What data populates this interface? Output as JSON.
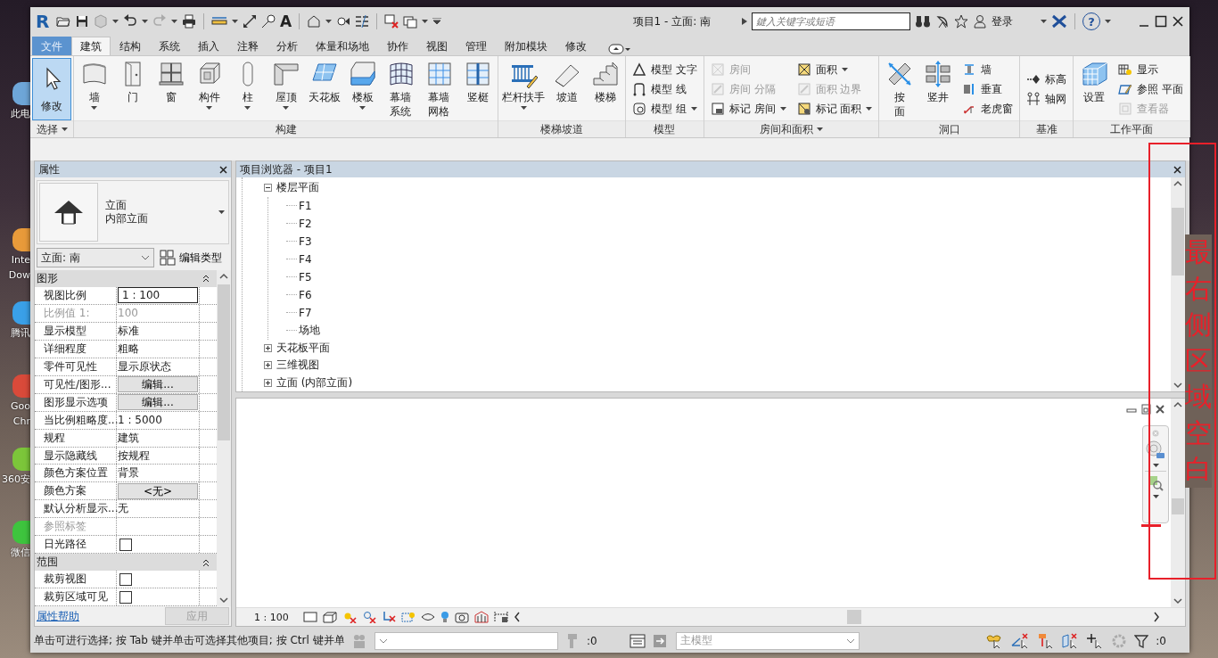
{
  "desktop_icons": [
    {
      "lines": [
        "此电"
      ]
    },
    {
      "lines": [
        "Inte",
        "Dow"
      ]
    },
    {
      "lines": [
        "腾讯"
      ]
    },
    {
      "lines": [
        "Goo",
        "Chr"
      ]
    },
    {
      "lines": [
        "360安"
      ]
    },
    {
      "lines": [
        "微信"
      ]
    }
  ],
  "window": {
    "logo": "R",
    "text_tool": "A",
    "title": "项目1 - 立面: 南",
    "search": {
      "placeholder": "鍵入关键字或短语"
    },
    "login": "登录",
    "help": "?"
  },
  "tabs": [
    {
      "label": "文件",
      "kind": "file",
      "selected": false
    },
    {
      "label": "建筑",
      "kind": "tab",
      "selected": true
    },
    {
      "label": "结构",
      "kind": "tab",
      "selected": false
    },
    {
      "label": "系统",
      "kind": "tab",
      "selected": false
    },
    {
      "label": "插入",
      "kind": "tab",
      "selected": false
    },
    {
      "label": "注释",
      "kind": "tab",
      "selected": false
    },
    {
      "label": "分析",
      "kind": "tab",
      "selected": false
    },
    {
      "label": "体量和场地",
      "kind": "tab",
      "selected": false
    },
    {
      "label": "协作",
      "kind": "tab",
      "selected": false
    },
    {
      "label": "视图",
      "kind": "tab",
      "selected": false
    },
    {
      "label": "管理",
      "kind": "tab",
      "selected": false
    },
    {
      "label": "附加模块",
      "kind": "tab",
      "selected": false
    },
    {
      "label": "修改",
      "kind": "tab",
      "selected": false
    }
  ],
  "ribbon": [
    {
      "title": "选择",
      "menu": true,
      "tools": [
        {
          "label": "修改",
          "kind": "large",
          "selected": true
        }
      ]
    },
    {
      "title": "构建",
      "tools": [
        {
          "label": "墙",
          "kind": "large",
          "dropdown": true
        },
        {
          "label": "门",
          "kind": "large"
        },
        {
          "label": "窗",
          "kind": "large"
        },
        {
          "label": "构件",
          "kind": "large",
          "dropdown": true
        },
        {
          "label": "柱",
          "kind": "large",
          "dropdown": true
        },
        {
          "label": "屋顶",
          "kind": "large",
          "dropdown": true
        },
        {
          "label": "天花板",
          "kind": "large"
        },
        {
          "label": "楼板",
          "kind": "large",
          "dropdown": true
        },
        {
          "label": "幕墙系统",
          "kind": "large",
          "wrap": true
        },
        {
          "label": "幕墙网格",
          "kind": "large",
          "wrap": true
        },
        {
          "label": "竖梃",
          "kind": "large"
        }
      ]
    },
    {
      "title": "楼梯坡道",
      "tools": [
        {
          "label": "栏杆扶手",
          "kind": "large",
          "dropdown": true
        },
        {
          "label": "坡道",
          "kind": "large"
        },
        {
          "label": "楼梯",
          "kind": "large"
        }
      ]
    },
    {
      "title": "模型",
      "tools": [
        {
          "label": "模型 文字",
          "kind": "small"
        },
        {
          "label": "模型 线",
          "kind": "small"
        },
        {
          "label": "模型 组",
          "kind": "small",
          "dropdown": true
        }
      ]
    },
    {
      "title": "房间和面积",
      "menu": true,
      "tools": [
        {
          "label": "房间",
          "kind": "small",
          "disabled": true
        },
        {
          "label": "房间 分隔",
          "kind": "small",
          "disabled": true
        },
        {
          "label": "标记 房间",
          "kind": "small",
          "dropdown": true
        },
        {
          "label": "面积",
          "kind": "small",
          "dropdown": true
        },
        {
          "label": "面积 边界",
          "kind": "small",
          "disabled": true
        },
        {
          "label": "标记 面积",
          "kind": "small",
          "dropdown": true
        }
      ]
    },
    {
      "title": "洞口",
      "tools": [
        {
          "label": "按面",
          "kind": "large",
          "wrap": true
        },
        {
          "label": "竖井",
          "kind": "large"
        },
        {
          "label": "墙",
          "kind": "small"
        },
        {
          "label": "垂直",
          "kind": "small"
        },
        {
          "label": "老虎窗",
          "kind": "small"
        }
      ]
    },
    {
      "title": "基准",
      "tools": [
        {
          "label": "标高",
          "kind": "small"
        },
        {
          "label": "轴网",
          "kind": "small"
        }
      ]
    },
    {
      "title": "工作平面",
      "tools": [
        {
          "label": "设置",
          "kind": "large"
        },
        {
          "label": "显示",
          "kind": "small"
        },
        {
          "label": "参照 平面",
          "kind": "small"
        },
        {
          "label": "查看器",
          "kind": "small",
          "disabled": true
        }
      ]
    }
  ],
  "properties": {
    "title": "属性",
    "type_name": "立面",
    "type_sub": "内部立面",
    "selector": "立面: 南",
    "edit_type": "编辑类型",
    "groups": [
      {
        "name": "图形",
        "expanded": true,
        "rows": [
          {
            "label": "视图比例",
            "value": "1 : 100",
            "kind": "input",
            "disabled": false
          },
          {
            "label": "比例值 1:",
            "value": "100",
            "kind": "text",
            "disabled": true
          },
          {
            "label": "显示模型",
            "value": "标准",
            "kind": "text",
            "disabled": false
          },
          {
            "label": "详细程度",
            "value": "粗略",
            "kind": "text",
            "disabled": false
          },
          {
            "label": "零件可见性",
            "value": "显示原状态",
            "kind": "text",
            "disabled": false
          },
          {
            "label": "可见性/图形...",
            "value": "编辑...",
            "kind": "button",
            "disabled": false
          },
          {
            "label": "图形显示选项",
            "value": "编辑...",
            "kind": "button",
            "disabled": false
          },
          {
            "label": "当比例粗略度...",
            "value": "1 : 5000",
            "kind": "text",
            "disabled": false
          },
          {
            "label": "规程",
            "value": "建筑",
            "kind": "text",
            "disabled": false
          },
          {
            "label": "显示隐藏线",
            "value": "按规程",
            "kind": "text",
            "disabled": false
          },
          {
            "label": "颜色方案位置",
            "value": "背景",
            "kind": "text",
            "disabled": false
          },
          {
            "label": "颜色方案",
            "value": "<无>",
            "kind": "button",
            "disabled": false
          },
          {
            "label": "默认分析显示...",
            "value": "无",
            "kind": "text",
            "disabled": false
          },
          {
            "label": "参照标签",
            "kind": "text",
            "disabled": true
          },
          {
            "label": "日光路径",
            "kind": "checkbox",
            "checked": false,
            "disabled": false
          }
        ]
      },
      {
        "name": "范围",
        "expanded": true,
        "rows": [
          {
            "label": "裁剪视图",
            "kind": "checkbox",
            "checked": false,
            "disabled": false
          },
          {
            "label": "裁剪区域可见",
            "kind": "checkbox",
            "checked": false,
            "disabled": false
          }
        ]
      }
    ],
    "help_link": "属性帮助",
    "apply": {
      "label": "应用",
      "disabled": true
    }
  },
  "browser": {
    "title": "项目浏览器 - 项目1",
    "tree": [
      {
        "label": "楼层平面",
        "expanded": true,
        "children": [
          {
            "label": "F1"
          },
          {
            "label": "F2"
          },
          {
            "label": "F3"
          },
          {
            "label": "F4"
          },
          {
            "label": "F5"
          },
          {
            "label": "F6"
          },
          {
            "label": "F7"
          },
          {
            "label": "场地"
          }
        ]
      },
      {
        "label": "天花板平面",
        "expanded": false
      },
      {
        "label": "三维视图",
        "expanded": false
      },
      {
        "label": "立面 (内部立面)",
        "expanded": false
      }
    ]
  },
  "view": {
    "scale": "1 : 100"
  },
  "status_bar": {
    "message": "单击可进行选择; 按 Tab 键并单击可选择其他项目; 按 Ctrl 键并单",
    "editable_count": ":0",
    "design_option": "主模型",
    "filter_count": ":0"
  },
  "annotation": {
    "text": "最右侧区域空白"
  }
}
